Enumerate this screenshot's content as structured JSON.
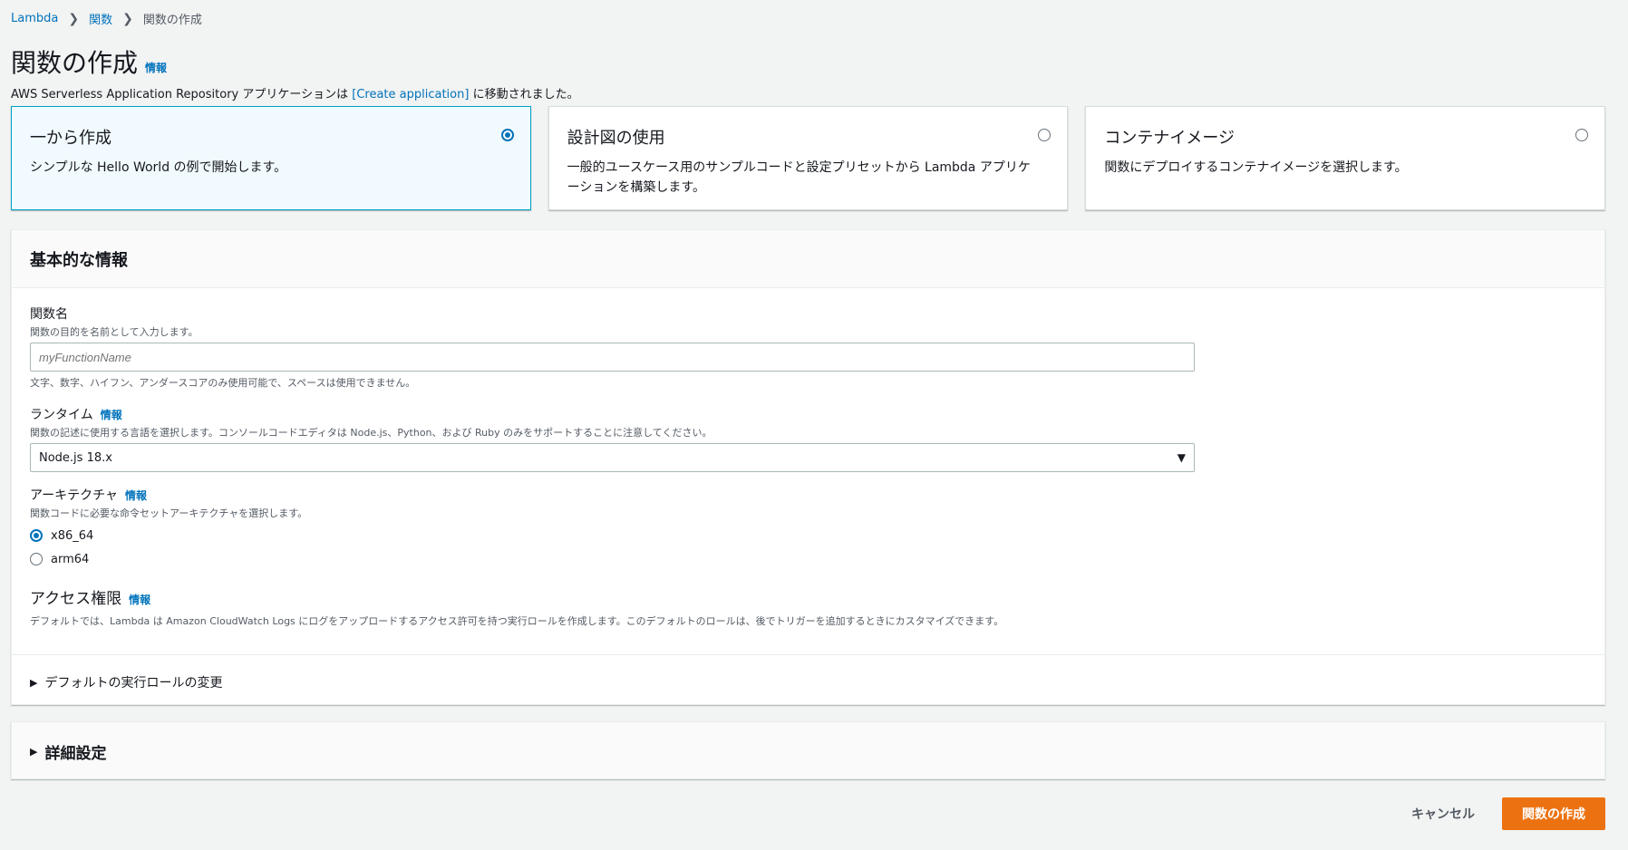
{
  "breadcrumb": {
    "items": [
      "Lambda",
      "関数"
    ],
    "current": "関数の作成"
  },
  "page": {
    "title": "関数の作成",
    "info": "情報",
    "notice_prefix": "AWS Serverless Application Repository アプリケーションは ",
    "notice_link": "[Create application]",
    "notice_suffix": " に移動されました。"
  },
  "tiles": [
    {
      "title": "一から作成",
      "desc": "シンプルな Hello World の例で開始します。",
      "selected": true
    },
    {
      "title": "設計図の使用",
      "desc": "一般的ユースケース用のサンプルコードと設定プリセットから Lambda アプリケーションを構築します。",
      "selected": false
    },
    {
      "title": "コンテナイメージ",
      "desc": "関数にデプロイするコンテナイメージを選択します。",
      "selected": false
    }
  ],
  "basic": {
    "header": "基本的な情報",
    "function_name": {
      "label": "関数名",
      "desc": "関数の目的を名前として入力します。",
      "placeholder": "myFunctionName",
      "constraint": "文字、数字、ハイフン、アンダースコアのみ使用可能で、スペースは使用できません。"
    },
    "runtime": {
      "label": "ランタイム",
      "info": "情報",
      "desc": "関数の記述に使用する言語を選択します。コンソールコードエディタは Node.js、Python、および Ruby のみをサポートすることに注意してください。",
      "value": "Node.js 18.x"
    },
    "architecture": {
      "label": "アーキテクチャ",
      "info": "情報",
      "desc": "関数コードに必要な命令セットアーキテクチャを選択します。",
      "options": [
        "x86_64",
        "arm64"
      ],
      "selected": "x86_64"
    },
    "permissions": {
      "label": "アクセス権限",
      "info": "情報",
      "desc": "デフォルトでは、Lambda は Amazon CloudWatch Logs にログをアップロードするアクセス許可を持つ実行ロールを作成します。このデフォルトのロールは、後でトリガーを追加するときにカスタマイズできます。"
    },
    "role_expander": "デフォルトの実行ロールの変更"
  },
  "advanced": {
    "label": "詳細設定"
  },
  "footer": {
    "cancel": "キャンセル",
    "create": "関数の作成"
  },
  "colors": {
    "primary_button": "#ec7211",
    "link": "#0073bb",
    "selected_tile_border": "#00a1c9"
  }
}
